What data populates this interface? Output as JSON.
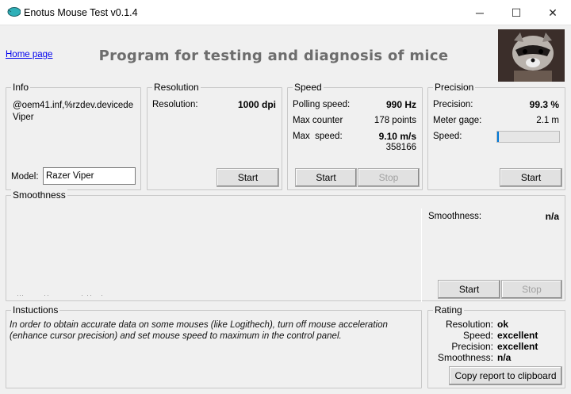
{
  "window": {
    "title": "Enotus Mouse Test v0.1.4",
    "minimize": "─",
    "maximize": "☐",
    "close": "✕"
  },
  "header": {
    "home_link": "Home page",
    "heading": "Program for testing and diagnosis of mice"
  },
  "info": {
    "title": "Info",
    "device_line1": "@oem41.inf,%rzdev.devicede",
    "device_line2": "Viper",
    "model_label": "Model:",
    "model_value": "Razer Viper"
  },
  "resolution": {
    "title": "Resolution",
    "label": "Resolution:",
    "value": "1000 dpi",
    "start": "Start"
  },
  "speed": {
    "title": "Speed",
    "polling_label": "Polling speed:",
    "polling_value": "990 Hz",
    "counter_label": "Max counter",
    "counter_value": "178 points",
    "max_label": "Max  speed:",
    "max_value": "9.10 m/s",
    "max_sub": "358166",
    "start": "Start",
    "stop": "Stop"
  },
  "precision": {
    "title": "Precision",
    "precision_label": "Precision:",
    "precision_value": "99.3 %",
    "gage_label": "Meter gage:",
    "gage_value": "2.1 m",
    "speed_label": "Speed:",
    "speed_fill_percent": 3,
    "start": "Start",
    "accent": "#0078d7"
  },
  "smoothness": {
    "title": "Smoothness",
    "label": "Smoothness:",
    "value": "n/a",
    "start": "Start",
    "stop": "Stop"
  },
  "instructions": {
    "title": "Instuctions",
    "text": "In order to obtain accurate data on some mouses (like Logithech), turn off mouse acceleration (enhance cursor precision) and set mouse speed to maximum in the control panel."
  },
  "rating": {
    "title": "Rating",
    "rows": [
      {
        "label": "Resolution:",
        "value": "ok"
      },
      {
        "label": "Speed:",
        "value": "excellent"
      },
      {
        "label": "Precision:",
        "value": "excellent"
      },
      {
        "label": "Smoothness:",
        "value": "n/a"
      }
    ],
    "copy": "Copy report to clipboard"
  }
}
